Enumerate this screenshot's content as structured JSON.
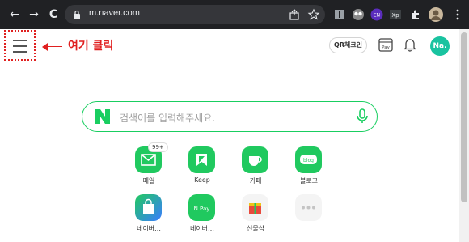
{
  "browser": {
    "back": "←",
    "forward": "→",
    "reload": "C",
    "url": "m.naver.com"
  },
  "annotation": {
    "text": "여기 클릭"
  },
  "header": {
    "qr_label": "QR체크인",
    "pay_label": "Pay",
    "avatar_text": "Na."
  },
  "search": {
    "placeholder": "검색어를 입력해주세요."
  },
  "services": [
    {
      "label": "메일",
      "badge": "99+"
    },
    {
      "label": "Keep"
    },
    {
      "label": "카페"
    },
    {
      "label": "블로그",
      "sub": "blog"
    },
    {
      "label": "네이버…"
    },
    {
      "label": "네이버…",
      "sub": "N Pay"
    },
    {
      "label": "선물샵"
    },
    {
      "label": ""
    }
  ],
  "colors": {
    "accent": "#19ce60",
    "annotation": "#e02020",
    "chrome": "#202124"
  }
}
